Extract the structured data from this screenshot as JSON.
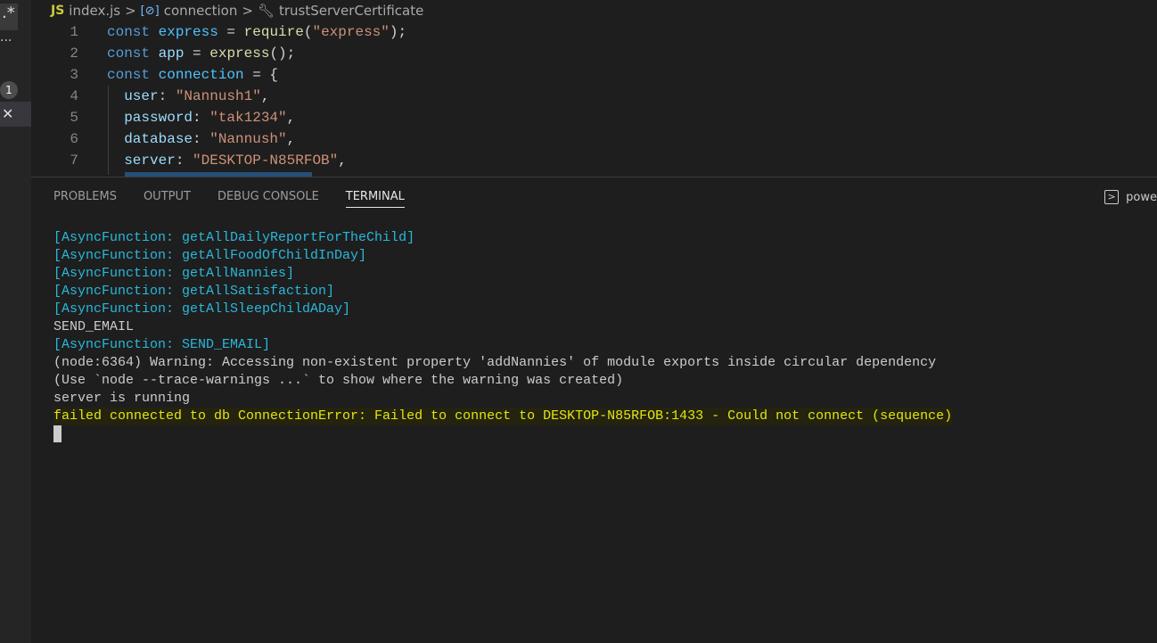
{
  "sidebar": {
    "star": ".*",
    "dots": "...",
    "badge": "1",
    "close": "✕"
  },
  "breadcrumb": {
    "file_icon": "JS",
    "file": "index.js",
    "sep": ">",
    "item1": "connection",
    "item2": "trustServerCertificate"
  },
  "code": [
    {
      "n": "1",
      "parts": [
        [
          "kw",
          "const "
        ],
        [
          "vr",
          "express"
        ],
        [
          "pn",
          " = "
        ],
        [
          "fn",
          "require"
        ],
        [
          "pn",
          "("
        ],
        [
          "st",
          "\"express\""
        ],
        [
          "pn",
          ");"
        ]
      ]
    },
    {
      "n": "2",
      "parts": [
        [
          "kw",
          "const "
        ],
        [
          "pr",
          "app"
        ],
        [
          "pn",
          " = "
        ],
        [
          "fn",
          "express"
        ],
        [
          "pn",
          "();"
        ]
      ]
    },
    {
      "n": "3",
      "parts": [
        [
          "kw",
          "const "
        ],
        [
          "vr",
          "connection"
        ],
        [
          "pn",
          " = {"
        ]
      ]
    },
    {
      "n": "4",
      "parts": [
        [
          "pr",
          "  user"
        ],
        [
          "pn",
          ": "
        ],
        [
          "st",
          "\"Nannush1\""
        ],
        [
          "pn",
          ","
        ]
      ]
    },
    {
      "n": "5",
      "parts": [
        [
          "pr",
          "  password"
        ],
        [
          "pn",
          ": "
        ],
        [
          "st",
          "\"tak1234\""
        ],
        [
          "pn",
          ","
        ]
      ]
    },
    {
      "n": "6",
      "parts": [
        [
          "pr",
          "  database"
        ],
        [
          "pn",
          ": "
        ],
        [
          "st",
          "\"Nannush\""
        ],
        [
          "pn",
          ","
        ]
      ]
    },
    {
      "n": "7",
      "parts": [
        [
          "pr",
          "  server"
        ],
        [
          "pn",
          ": "
        ],
        [
          "st",
          "\"DESKTOP-N85RFOB\""
        ],
        [
          "pn",
          ","
        ]
      ]
    }
  ],
  "panel": {
    "tabs": [
      "PROBLEMS",
      "OUTPUT",
      "DEBUG CONSOLE",
      "TERMINAL"
    ],
    "active": "TERMINAL",
    "shell": "powe"
  },
  "terminal": [
    {
      "c": "cy",
      "t": "[AsyncFunction: getAllDailyReportForTheChild]"
    },
    {
      "c": "cy",
      "t": "[AsyncFunction: getAllFoodOfChildInDay]"
    },
    {
      "c": "cy",
      "t": "[AsyncFunction: getAllNannies]"
    },
    {
      "c": "cy",
      "t": "[AsyncFunction: getAllSatisfaction]"
    },
    {
      "c": "cy",
      "t": "[AsyncFunction: getAllSleepChildADay]"
    },
    {
      "c": "",
      "t": "SEND_EMAIL"
    },
    {
      "c": "cy",
      "t": "[AsyncFunction: SEND_EMAIL]"
    },
    {
      "c": "",
      "t": "(node:6364) Warning: Accessing non-existent property 'addNannies' of module exports inside circular dependency"
    },
    {
      "c": "",
      "t": "(Use `node --trace-warnings ...` to show where the warning was created)"
    },
    {
      "c": "",
      "t": "server is running"
    },
    {
      "c": "yl hl",
      "t": "failed connected to db ConnectionError: Failed to connect to DESKTOP-N85RFOB:1433 - Could not connect (sequence)"
    }
  ]
}
